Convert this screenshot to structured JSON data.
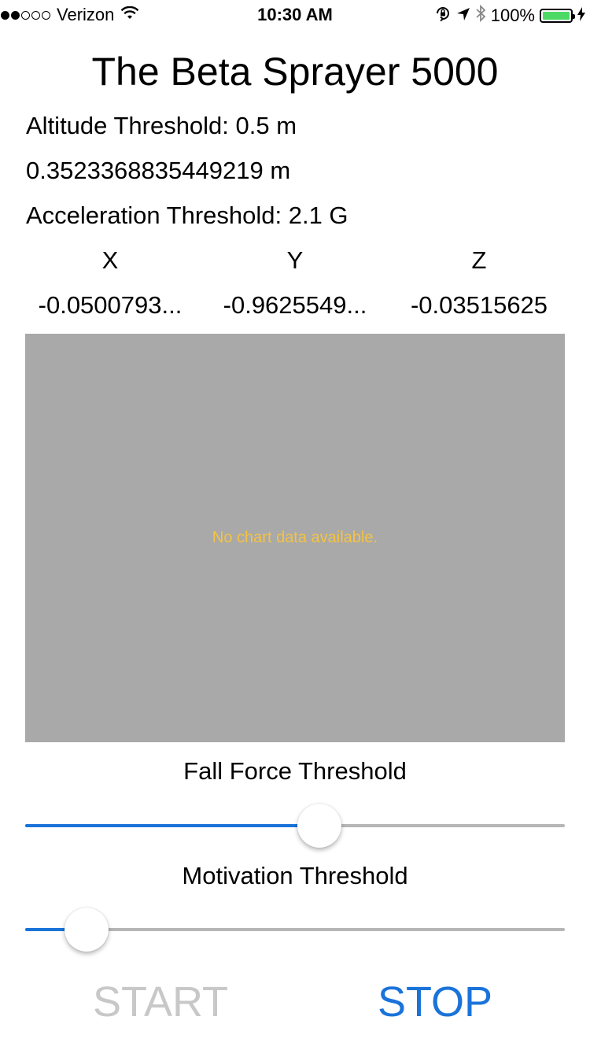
{
  "status_bar": {
    "carrier": "Verizon",
    "signal_bars_filled": 2,
    "signal_bars_total": 5,
    "time": "10:30 AM",
    "battery_percent": "100%",
    "battery_color": "#4cd964"
  },
  "app": {
    "title": "The Beta Sprayer 5000"
  },
  "readouts": {
    "altitude_threshold": "Altitude Threshold: 0.5 m",
    "altitude_value": "0.3523368835449219 m",
    "acceleration_threshold": "Acceleration Threshold: 2.1 G"
  },
  "axes": {
    "x_label": "X",
    "y_label": "Y",
    "z_label": "Z",
    "x_value": "-0.0500793...",
    "y_value": "-0.9625549...",
    "z_value": "-0.03515625"
  },
  "chart": {
    "empty_message": "No chart data available.",
    "background_color": "#a9a9a9",
    "message_color": "#f5c342"
  },
  "sliders": {
    "fall_force": {
      "label": "Fall Force Threshold",
      "value_fraction": 0.545
    },
    "motivation": {
      "label": "Motivation Threshold",
      "value_fraction": 0.113
    }
  },
  "buttons": {
    "start_label": "START",
    "stop_label": "STOP",
    "accent_color": "#1a73d9",
    "disabled_color": "#c8c8c8"
  }
}
